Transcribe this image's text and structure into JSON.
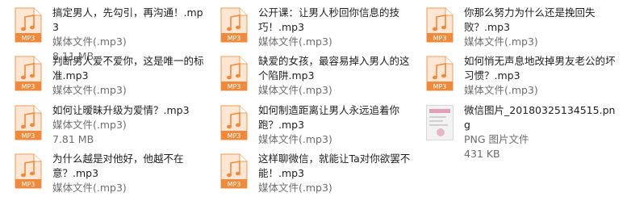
{
  "colors": {
    "accent": "#f08a3a",
    "icon_bg": "#fbd9bf",
    "icon_border": "#f19a52"
  },
  "files": [
    {
      "name": "搞定男人，先勾引，再沟通！.mp3",
      "type": "媒体文件(.mp3)",
      "size": "8.11 MB",
      "icon": "mp3-file-icon",
      "badge": "MP3"
    },
    {
      "name": "公开课：让男人秒回你信息的技巧！.mp3",
      "type": "媒体文件(.mp3)",
      "size": "",
      "icon": "mp3-file-icon",
      "badge": "MP3"
    },
    {
      "name": "你那么努力为什么还是挽回失败？.mp3",
      "type": "媒体文件(.mp3)",
      "size": "",
      "icon": "mp3-file-icon",
      "badge": "MP3"
    },
    {
      "name": "判断男人爱不爱你，这是唯一的标准.mp3",
      "type": "媒体文件(.mp3)",
      "size": "",
      "icon": "mp3-file-icon",
      "badge": "MP3"
    },
    {
      "name": "缺爱的女孩，最容易掉入男人的这个陷阱.mp3",
      "type": "媒体文件(.mp3)",
      "size": "",
      "icon": "mp3-file-icon",
      "badge": "MP3"
    },
    {
      "name": "如何悄无声息地改掉男友老公的坏习惯？.mp3",
      "type": "媒体文件(.mp3)",
      "size": "",
      "icon": "mp3-file-icon",
      "badge": "MP3"
    },
    {
      "name": "如何让暧昧升级为爱情？.mp3",
      "type": "媒体文件(.mp3)",
      "size": "7.81 MB",
      "icon": "mp3-file-icon",
      "badge": "MP3"
    },
    {
      "name": "如何制造距离让男人永远追着你跑？.mp3",
      "type": "媒体文件(.mp3)",
      "size": "",
      "icon": "mp3-file-icon",
      "badge": "MP3"
    },
    {
      "name": "微信图片_20180325134515.png",
      "type": "PNG 图片文件",
      "size": "431 KB",
      "icon": "png-thumbnail-icon",
      "badge": ""
    },
    {
      "name": "为什么越是对他好，他越不在意？.mp3",
      "type": "媒体文件(.mp3)",
      "size": "",
      "icon": "mp3-file-icon",
      "badge": "MP3"
    },
    {
      "name": "这样聊微信，就能让Ta对你欲罢不能！.mp3",
      "type": "媒体文件(.mp3)",
      "size": "",
      "icon": "mp3-file-icon",
      "badge": "MP3"
    }
  ]
}
